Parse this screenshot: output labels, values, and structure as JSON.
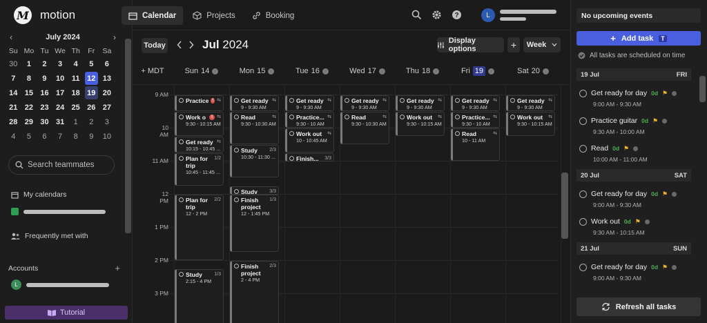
{
  "app": {
    "name": "motion",
    "logo_letter": "M"
  },
  "minical": {
    "month": "July 2024",
    "prev": "‹",
    "next": "›",
    "dow": [
      "Su",
      "Mo",
      "Tu",
      "We",
      "Th",
      "Fr",
      "Sa"
    ],
    "weeks": [
      [
        "30",
        "1",
        "2",
        "3",
        "4",
        "5",
        "6"
      ],
      [
        "7",
        "8",
        "9",
        "10",
        "11",
        "12",
        "13"
      ],
      [
        "14",
        "15",
        "16",
        "17",
        "18",
        "19",
        "20"
      ],
      [
        "21",
        "22",
        "23",
        "24",
        "25",
        "26",
        "27"
      ],
      [
        "28",
        "29",
        "30",
        "31",
        "1",
        "2",
        "3"
      ],
      [
        "4",
        "5",
        "6",
        "7",
        "8",
        "9",
        "10"
      ]
    ]
  },
  "sidebar": {
    "search_placeholder": "Search teammates",
    "my_calendars": "My calendars",
    "frequently_met": "Frequently met with",
    "accounts": "Accounts",
    "accounts_add": "+",
    "avatar_letter": "L",
    "tutorial": "Tutorial"
  },
  "header": {
    "tabs": [
      {
        "label": "Calendar"
      },
      {
        "label": "Projects"
      },
      {
        "label": "Booking"
      }
    ],
    "user_letter": "L"
  },
  "controls": {
    "today": "Today",
    "month": "Jul",
    "year": "2024",
    "display_options": "Display options",
    "add": "+",
    "view": "Week"
  },
  "tz": "+ MDT",
  "days": [
    {
      "name": "Sun",
      "num": "14"
    },
    {
      "name": "Mon",
      "num": "15"
    },
    {
      "name": "Tue",
      "num": "16"
    },
    {
      "name": "Wed",
      "num": "17"
    },
    {
      "name": "Thu",
      "num": "18"
    },
    {
      "name": "Fri",
      "num": "19"
    },
    {
      "name": "Sat",
      "num": "20"
    }
  ],
  "hours": [
    "9 AM",
    "10 AM",
    "11 AM",
    "12 PM",
    "1 PM",
    "2 PM",
    "3 PM"
  ],
  "events": [
    {
      "day": 0,
      "title": "Practice",
      "time": "",
      "start": 9.0,
      "end": 9.5,
      "badge": "!"
    },
    {
      "day": 0,
      "title": "Work o",
      "time": "9:30 - 10:15 AM",
      "start": 9.5,
      "end": 10.25,
      "badge": "!"
    },
    {
      "day": 0,
      "title": "Get ready",
      "time": "10:15 - 10:45 ...",
      "start": 10.25,
      "end": 10.75
    },
    {
      "day": 0,
      "title": "Plan for trip",
      "time": "10:45 - 11:45 ...",
      "start": 10.75,
      "end": 11.75,
      "frac": "1/2"
    },
    {
      "day": 0,
      "title": "Plan for trip",
      "time": "12 - 2 PM",
      "start": 12,
      "end": 14,
      "frac": "2/2"
    },
    {
      "day": 0,
      "title": "Study",
      "time": "2:15 - 4 PM",
      "start": 14.25,
      "end": 16,
      "frac": "1/3"
    },
    {
      "day": 1,
      "title": "Get ready",
      "time": "9 - 9:30 AM",
      "start": 9,
      "end": 9.5
    },
    {
      "day": 1,
      "title": "Read",
      "time": "9:30 - 10:30 AM",
      "start": 9.5,
      "end": 10.5
    },
    {
      "day": 1,
      "title": "Study",
      "time": "10:30 - 11:30 ...",
      "start": 10.5,
      "end": 11.5,
      "frac": "2/3"
    },
    {
      "day": 1,
      "title": "Study",
      "time": "",
      "start": 11.75,
      "end": 12,
      "frac": "3/3"
    },
    {
      "day": 1,
      "title": "Finish project",
      "time": "12 - 1:45 PM",
      "start": 12,
      "end": 13.75,
      "frac": "1/3"
    },
    {
      "day": 1,
      "title": "Finish project",
      "time": "2 - 4 PM",
      "start": 14,
      "end": 16,
      "frac": "2/3"
    },
    {
      "day": 2,
      "title": "Get ready",
      "time": "9 - 9:30 AM",
      "start": 9,
      "end": 9.5
    },
    {
      "day": 2,
      "title": "Practice...",
      "time": "9:30 - 10 AM",
      "start": 9.5,
      "end": 10
    },
    {
      "day": 2,
      "title": "Work out",
      "time": "10 - 10:45 AM",
      "start": 10,
      "end": 10.75
    },
    {
      "day": 2,
      "title": "Finish...",
      "time": "",
      "start": 10.75,
      "end": 11,
      "frac": "3/3"
    },
    {
      "day": 3,
      "title": "Get ready",
      "time": "9 - 9:30 AM",
      "start": 9,
      "end": 9.5
    },
    {
      "day": 3,
      "title": "Read",
      "time": "9:30 - 10:30 AM",
      "start": 9.5,
      "end": 10.5
    },
    {
      "day": 4,
      "title": "Get ready",
      "time": "9 - 9:30 AM",
      "start": 9,
      "end": 9.5
    },
    {
      "day": 4,
      "title": "Work out",
      "time": "9:30 - 10:15 AM",
      "start": 9.5,
      "end": 10.25
    },
    {
      "day": 5,
      "title": "Get ready",
      "time": "9 - 9:30 AM",
      "start": 9,
      "end": 9.5
    },
    {
      "day": 5,
      "title": "Practice...",
      "time": "9:30 - 10 AM",
      "start": 9.5,
      "end": 10
    },
    {
      "day": 5,
      "title": "Read",
      "time": "10 - 11 AM",
      "start": 10,
      "end": 11
    },
    {
      "day": 6,
      "title": "Get ready",
      "time": "9 - 9:30 AM",
      "start": 9,
      "end": 9.5
    },
    {
      "day": 6,
      "title": "Work out",
      "time": "9:30 - 10:15 AM",
      "start": 9.5,
      "end": 10.25
    }
  ],
  "right": {
    "no_events": "No upcoming events",
    "add_task": "Add task",
    "add_task_key": "T",
    "scheduled": "All tasks are scheduled on time",
    "refresh": "Refresh all tasks",
    "bands": [
      {
        "date": "19 Jul",
        "dow": "FRI"
      },
      {
        "date": "20 Jul",
        "dow": "SAT"
      },
      {
        "date": "21 Jul",
        "dow": "SUN"
      }
    ],
    "tasks": [
      {
        "name": "Get ready for day",
        "dur": "0d",
        "time": "9:00 AM - 9:30 AM"
      },
      {
        "name": "Practice guitar",
        "dur": "0d",
        "time": "9:30 AM - 10:00 AM"
      },
      {
        "name": "Read",
        "dur": "0d",
        "time": "10:00 AM - 11:00 AM"
      },
      {
        "name": "Get ready for day",
        "dur": "0d",
        "time": "9:00 AM - 9:30 AM"
      },
      {
        "name": "Work out",
        "dur": "0d",
        "time": "9:30 AM - 10:15 AM"
      },
      {
        "name": "Get ready for day",
        "dur": "0d",
        "time": "9:00 AM - 9:30 AM"
      }
    ]
  }
}
